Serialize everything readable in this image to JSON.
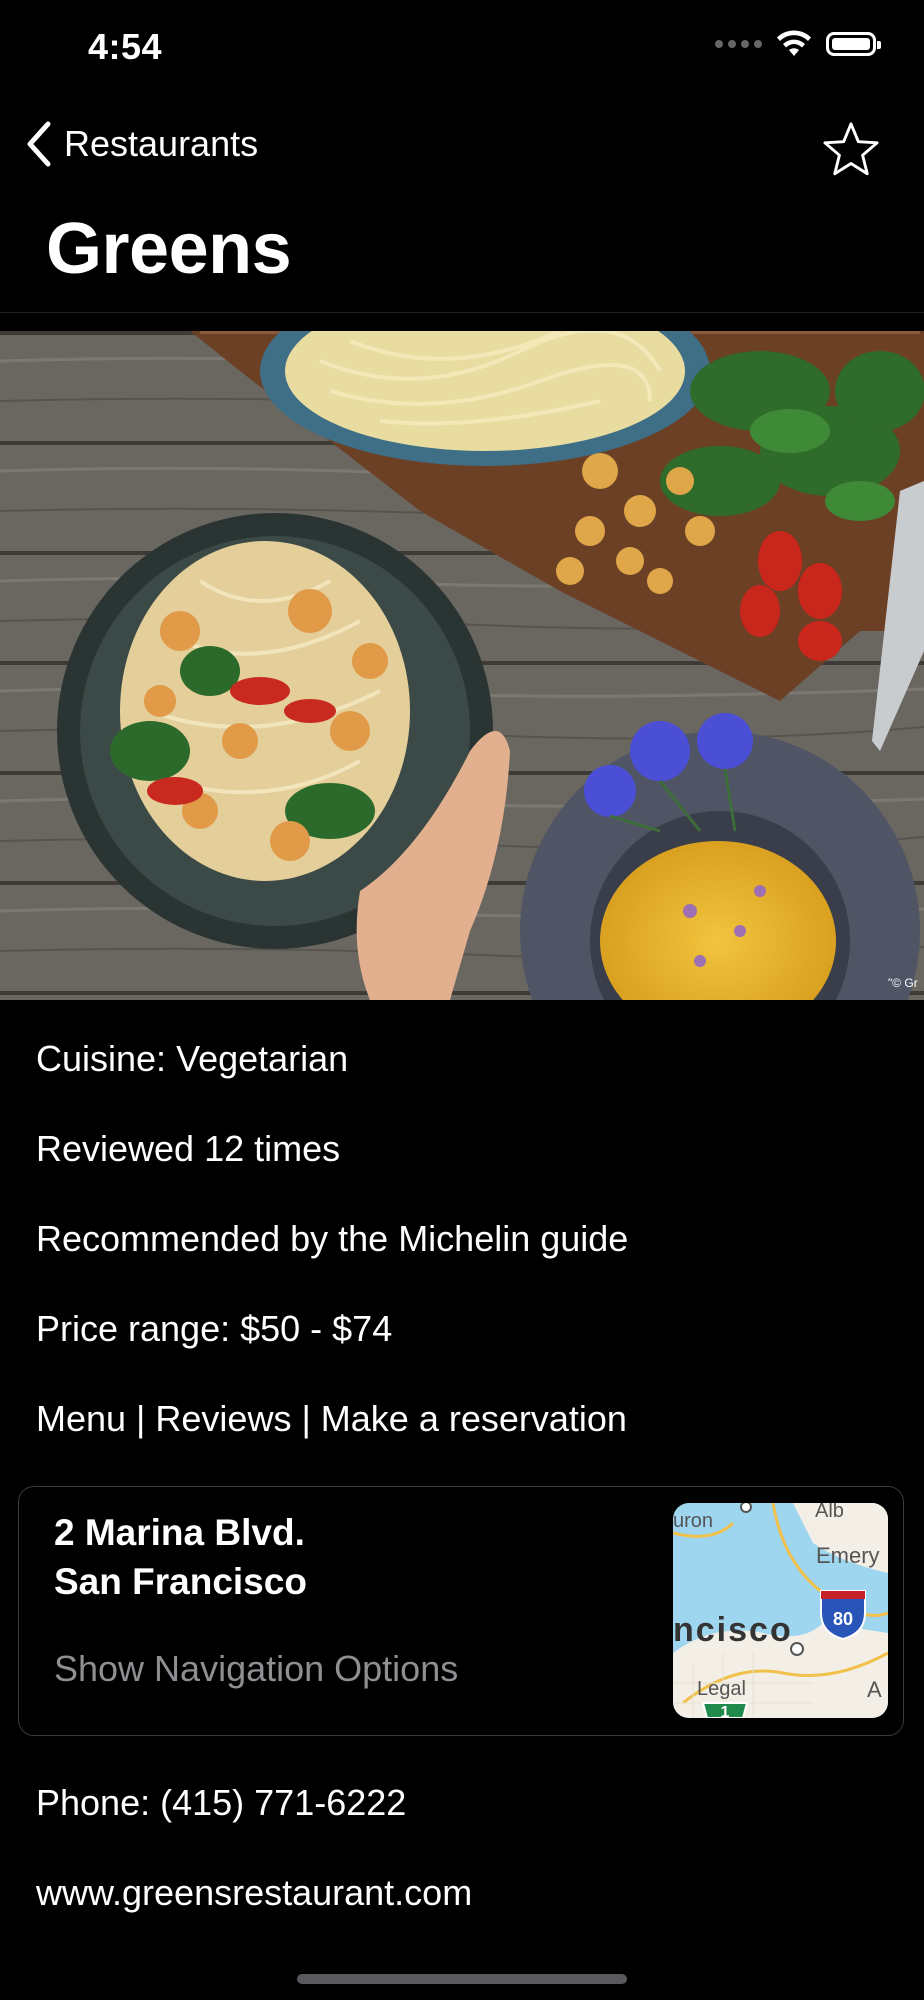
{
  "status_bar": {
    "time": "4:54"
  },
  "nav": {
    "back_label": "Restaurants",
    "title": "Greens"
  },
  "details": {
    "cuisine": "Cuisine: Vegetarian",
    "reviews": "Reviewed 12 times",
    "recommendation": "Recommended by the Michelin guide",
    "price": "Price range: $50 - $74",
    "links": "Menu | Reviews | Make a reservation"
  },
  "address_card": {
    "line1": "2 Marina Blvd.",
    "line2": "San Francisco",
    "nav_options": "Show Navigation Options",
    "map": {
      "label_city": "ncisco",
      "label_top_left": "uron",
      "label_emery": "Emery",
      "label_top_right": "Alb",
      "label_legal": "Legal",
      "label_right": "A",
      "highway_80": "80",
      "highway_1": "1"
    }
  },
  "contact": {
    "phone": "Phone: (415) 771-6222",
    "website": "www.greensrestaurant.com"
  },
  "photo_credit": "\"© Gr"
}
